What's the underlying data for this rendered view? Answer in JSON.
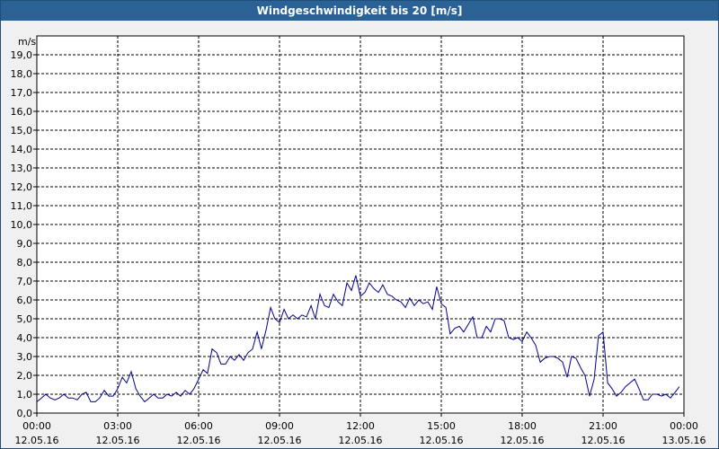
{
  "window": {
    "title": "Windgeschwindigkeit bis 20 [m/s]"
  },
  "colors": {
    "titlebar": "#2a6296",
    "line": "#00008b",
    "grid": "#000000",
    "background": "#ffffff"
  },
  "chart_data": {
    "type": "line",
    "title": "Windgeschwindigkeit bis 20 [m/s]",
    "ylabel": "m/s",
    "xlabel": "",
    "ylim": [
      0,
      20
    ],
    "xlim": [
      0,
      24
    ],
    "grid": true,
    "y_ticks": [
      {
        "value": 0,
        "label": "0,0"
      },
      {
        "value": 1,
        "label": "1,0"
      },
      {
        "value": 2,
        "label": "2,0"
      },
      {
        "value": 3,
        "label": "3,0"
      },
      {
        "value": 4,
        "label": "4,0"
      },
      {
        "value": 5,
        "label": "5,0"
      },
      {
        "value": 6,
        "label": "6,0"
      },
      {
        "value": 7,
        "label": "7,0"
      },
      {
        "value": 8,
        "label": "8,0"
      },
      {
        "value": 9,
        "label": "9,0"
      },
      {
        "value": 10,
        "label": "10,0"
      },
      {
        "value": 11,
        "label": "11,0"
      },
      {
        "value": 12,
        "label": "12,0"
      },
      {
        "value": 13,
        "label": "13,0"
      },
      {
        "value": 14,
        "label": "14,0"
      },
      {
        "value": 15,
        "label": "15,0"
      },
      {
        "value": 16,
        "label": "16,0"
      },
      {
        "value": 17,
        "label": "17,0"
      },
      {
        "value": 18,
        "label": "18,0"
      },
      {
        "value": 19,
        "label": "19,0"
      }
    ],
    "x_ticks": [
      {
        "value": 0,
        "time": "00:00",
        "date": "12.05.16"
      },
      {
        "value": 3,
        "time": "03:00",
        "date": "12.05.16"
      },
      {
        "value": 6,
        "time": "06:00",
        "date": "12.05.16"
      },
      {
        "value": 9,
        "time": "09:00",
        "date": "12.05.16"
      },
      {
        "value": 12,
        "time": "12:00",
        "date": "12.05.16"
      },
      {
        "value": 15,
        "time": "15:00",
        "date": "12.05.16"
      },
      {
        "value": 18,
        "time": "18:00",
        "date": "12.05.16"
      },
      {
        "value": 21,
        "time": "21:00",
        "date": "12.05.16"
      },
      {
        "value": 24,
        "time": "00:00",
        "date": "13.05.16"
      }
    ],
    "series": [
      {
        "x": [
          0.0,
          0.17,
          0.33,
          0.5,
          0.67,
          0.83,
          1.0,
          1.17,
          1.33,
          1.5,
          1.67,
          1.83,
          2.0,
          2.17,
          2.33,
          2.5,
          2.67,
          2.83,
          3.0,
          3.17,
          3.33,
          3.5,
          3.67,
          3.83,
          4.0,
          4.17,
          4.33,
          4.5,
          4.67,
          4.83,
          5.0,
          5.17,
          5.33,
          5.5,
          5.67,
          5.83,
          6.0,
          6.17,
          6.33,
          6.5,
          6.67,
          6.83,
          7.0,
          7.17,
          7.33,
          7.5,
          7.67,
          7.83,
          8.0,
          8.17,
          8.33,
          8.5,
          8.67,
          8.83,
          9.0,
          9.17,
          9.33,
          9.5,
          9.67,
          9.83,
          10.0,
          10.17,
          10.33,
          10.5,
          10.67,
          10.83,
          11.0,
          11.17,
          11.33,
          11.5,
          11.67,
          11.83,
          12.0,
          12.17,
          12.33,
          12.5,
          12.67,
          12.83,
          13.0,
          13.17,
          13.33,
          13.5,
          13.67,
          13.83,
          14.0,
          14.17,
          14.33,
          14.5,
          14.67,
          14.83,
          15.0,
          15.17,
          15.33,
          15.5,
          15.67,
          15.83,
          16.0,
          16.17,
          16.33,
          16.5,
          16.67,
          16.83,
          17.0,
          17.17,
          17.33,
          17.5,
          17.67,
          17.83,
          18.0,
          18.17,
          18.33,
          18.5,
          18.67,
          18.83,
          19.0,
          19.17,
          19.33,
          19.5,
          19.67,
          19.83,
          20.0,
          20.17,
          20.33,
          20.5,
          20.67,
          20.83,
          21.0,
          21.17,
          21.33,
          21.5,
          21.67,
          21.83,
          22.0,
          22.17,
          22.33,
          22.5,
          22.67,
          22.83,
          23.0,
          23.17,
          23.33,
          23.5,
          23.67,
          23.83
        ],
        "y": [
          0.6,
          0.8,
          1.0,
          0.8,
          0.7,
          0.8,
          1.0,
          0.8,
          0.8,
          0.7,
          1.0,
          1.1,
          0.6,
          0.6,
          0.8,
          1.2,
          0.9,
          0.9,
          1.3,
          1.9,
          1.6,
          2.2,
          1.3,
          0.9,
          0.6,
          0.8,
          1.0,
          0.8,
          0.8,
          1.0,
          0.9,
          1.1,
          0.9,
          1.2,
          1.0,
          1.3,
          1.8,
          2.3,
          2.1,
          3.4,
          3.2,
          2.6,
          2.6,
          3.0,
          2.8,
          3.1,
          2.8,
          3.2,
          3.4,
          4.3,
          3.4,
          4.4,
          5.6,
          5.0,
          4.8,
          5.5,
          5.0,
          5.2,
          5.0,
          5.2,
          5.1,
          5.7,
          5.0,
          6.3,
          5.7,
          5.6,
          6.3,
          5.9,
          5.7,
          6.9,
          6.5,
          7.3,
          6.2,
          6.4,
          6.9,
          6.6,
          6.4,
          6.8,
          6.3,
          6.2,
          6.0,
          5.9,
          5.6,
          6.1,
          5.7,
          6.0,
          5.8,
          5.9,
          5.5,
          6.7,
          5.8,
          5.6,
          4.2,
          4.5,
          4.6,
          4.3,
          4.7,
          5.1,
          4.0,
          4.0,
          4.6,
          4.3,
          5.0,
          5.0,
          4.9,
          4.0,
          3.9,
          4.0,
          3.8,
          4.3,
          4.0,
          3.6,
          2.7,
          2.9,
          3.0,
          3.0,
          2.9,
          2.7,
          1.9,
          3.0,
          2.9,
          2.4,
          2.0,
          0.9,
          1.8,
          4.1,
          4.3,
          1.6,
          1.3,
          0.9,
          1.1,
          1.4,
          1.6,
          1.8,
          1.3,
          0.7,
          0.7,
          1.0,
          1.0,
          0.9,
          1.0,
          0.8,
          1.1,
          1.4
        ]
      }
    ]
  }
}
